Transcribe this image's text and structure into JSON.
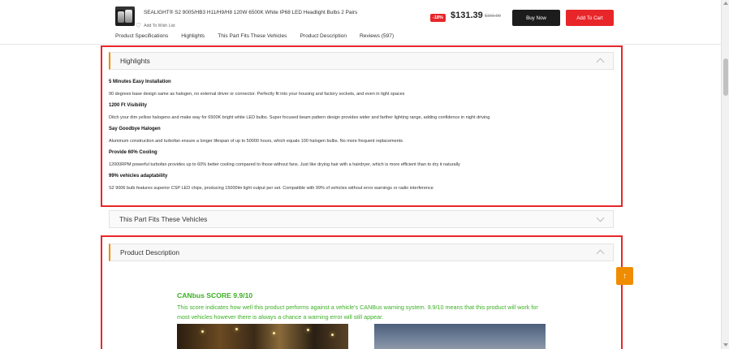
{
  "header": {
    "product_title": "SEALIGHT® S2 9005/HB3 H11/H9/H8 120W 6500K White IP68 LED Headlight Bulbs 2 Pairs",
    "wish_label": "Add To Wish List",
    "discount_badge": "-18%",
    "price": "$131.39",
    "old_price": "$159.99",
    "buy_now_label": "Buy Now",
    "add_to_cart_label": "Add To Cart",
    "tabs": [
      {
        "label": "Product Specifications"
      },
      {
        "label": "Highlights"
      },
      {
        "label": "This Part Fits These Vehicles"
      },
      {
        "label": "Product Description"
      },
      {
        "label": "Reviews (597)"
      }
    ]
  },
  "highlights": {
    "title": "Highlights",
    "items": [
      {
        "heading": "5 Minutes Easy Installation",
        "text": "90 degrees base design same as halogen, no external driver or connector. Perfectly fit into your housing and factory sockets, and even in tight spaces"
      },
      {
        "heading": "1200 Ft Visibility",
        "text": "Ditch your dim yellow halogens and make way for 6500K bright white LED bulbs. Super focused beam pattern design provides wider and farther lighting range, adding confidence in night driving"
      },
      {
        "heading": "Say Goodbye Halogen",
        "text": "Aluminum construction and turbofan ensure a longer lifespan of up to 50000 hours, which equals 100 halogen bulbs. No more frequent replacements"
      },
      {
        "heading": "Provide 60% Cooling",
        "text": "12000RPM powerful turbofan provides up to 60% better cooling compared to those without fans. Just like drying hair with a hairdryer, which is more efficient than to dry it naturally"
      },
      {
        "heading": "99% vehicles adaptability",
        "text": "S2 9006 bulb features superior CSP LED chips, producing 15000lm light output per set. Compatible with 99% of vehicles without error warnings or radio interference"
      }
    ]
  },
  "fits": {
    "title": "This Part Fits These Vehicles"
  },
  "description": {
    "title": "Product Description",
    "canbus_title": "CANbus SCORE 9.9/10",
    "canbus_text": "This score indicates how well this product performs against a vehicle's CANBus warning system. 9.9/10 means that this product will work for most vehicles however there is always a chance a warning error will still appear."
  },
  "scroll_top_icon": "arrow-up-icon",
  "colors": {
    "accent": "#f08c00",
    "brand_red": "#e8262a",
    "canbus_green": "#3cb024"
  }
}
